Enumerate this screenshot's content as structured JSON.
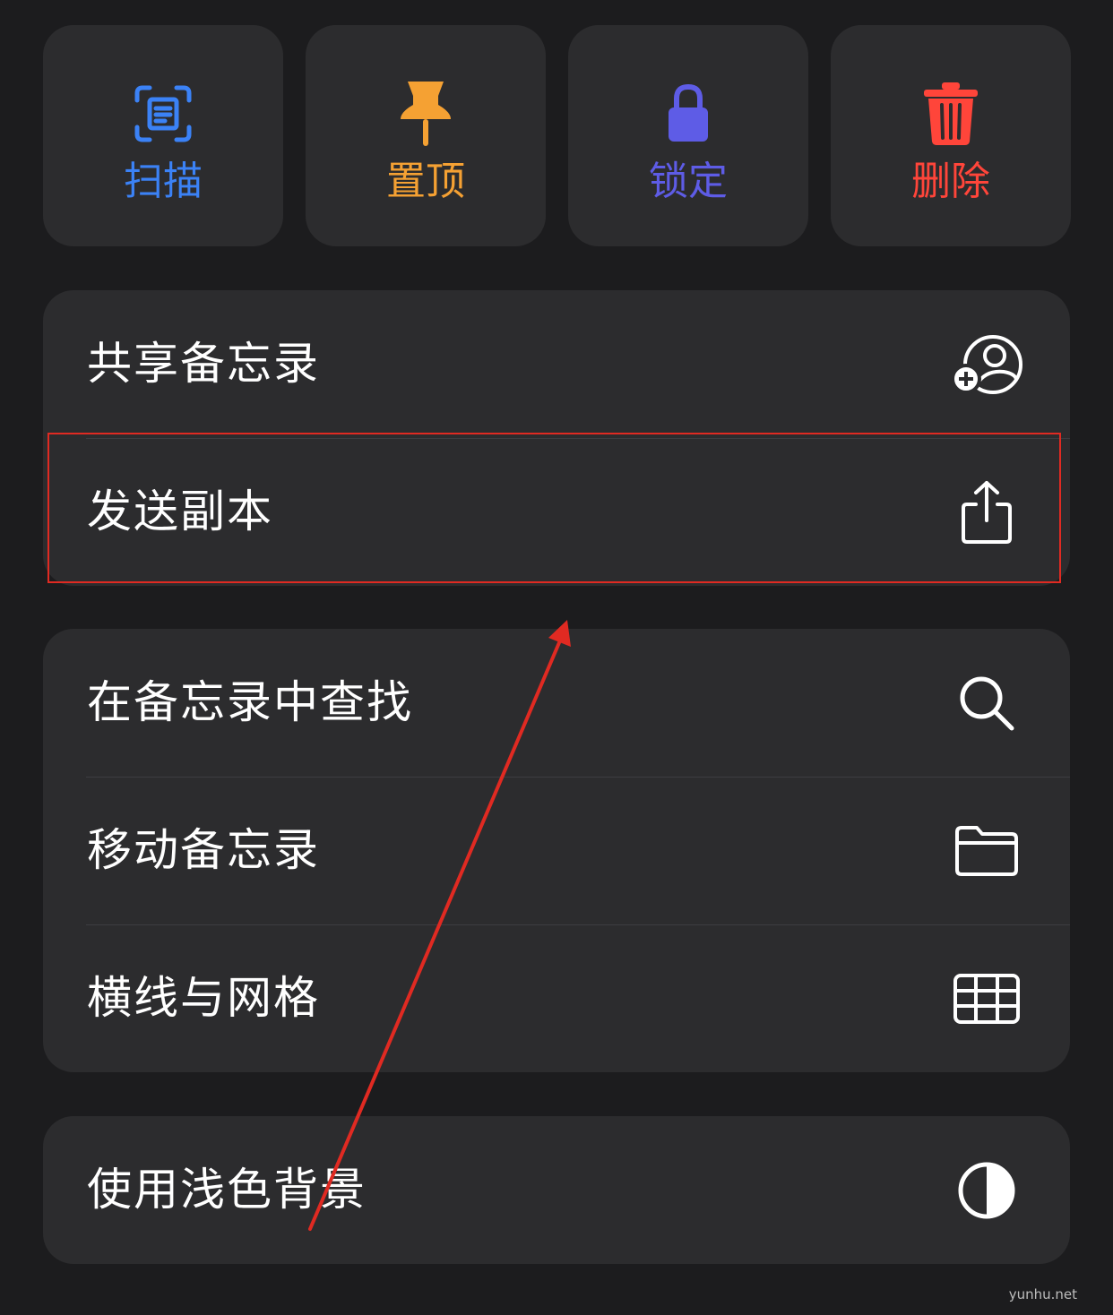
{
  "quick_actions": [
    {
      "label": "扫描",
      "icon": "scan-icon",
      "color": "#3b82f6"
    },
    {
      "label": "置顶",
      "icon": "pin-icon",
      "color": "#f5a133"
    },
    {
      "label": "锁定",
      "icon": "lock-icon",
      "color": "#5e5ce6"
    },
    {
      "label": "删除",
      "icon": "trash-icon",
      "color": "#ff453a"
    }
  ],
  "menu": {
    "group1": [
      {
        "label": "共享备忘录",
        "icon": "share-person-add-icon"
      },
      {
        "label": "发送副本",
        "icon": "share-upload-icon"
      }
    ],
    "group2": [
      {
        "label": "在备忘录中查找",
        "icon": "search-icon"
      },
      {
        "label": "移动备忘录",
        "icon": "folder-icon"
      },
      {
        "label": "横线与网格",
        "icon": "grid-icon"
      }
    ],
    "group3": [
      {
        "label": "使用浅色背景",
        "icon": "half-circle-icon"
      }
    ]
  },
  "annotation": {
    "highlight_color": "#e02a22"
  },
  "watermark": "yunhu.net"
}
